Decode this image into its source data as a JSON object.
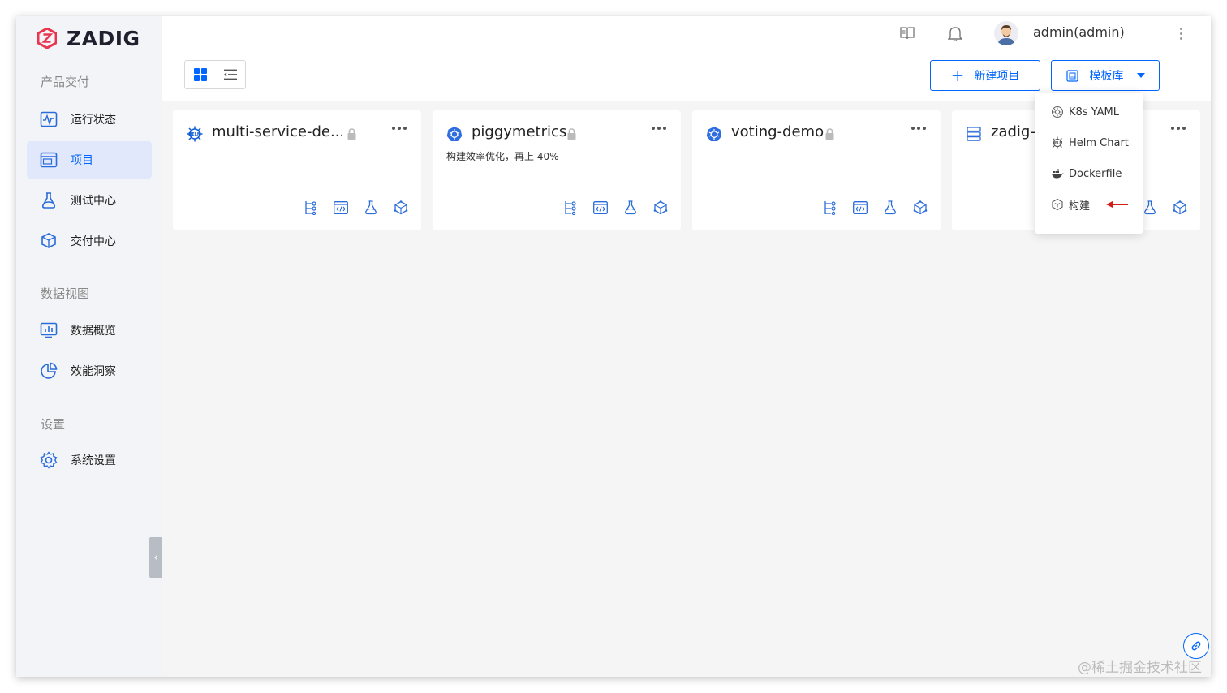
{
  "brand": {
    "name": "ZADIG",
    "accent": "#0066ff",
    "logo_color": "#e8364e"
  },
  "sidebar": {
    "sections": [
      {
        "title": "产品交付",
        "items": [
          {
            "label": "运行状态",
            "icon": "pulse-monitor-icon"
          },
          {
            "label": "项目",
            "icon": "pm-window-icon",
            "active": true
          },
          {
            "label": "测试中心",
            "icon": "flask-icon"
          },
          {
            "label": "交付中心",
            "icon": "package-cube-icon"
          }
        ]
      },
      {
        "title": "数据视图",
        "items": [
          {
            "label": "数据概览",
            "icon": "bar-monitor-icon"
          },
          {
            "label": "效能洞察",
            "icon": "pie-chart-icon"
          }
        ]
      },
      {
        "title": "设置",
        "items": [
          {
            "label": "系统设置",
            "icon": "gear-icon"
          }
        ]
      }
    ],
    "collapse_glyph": "‹"
  },
  "header": {
    "username": "admin(admin)",
    "icons": [
      "book-icon",
      "bell-icon",
      "avatar",
      "more-vertical-icon"
    ]
  },
  "toolbar": {
    "new_project_label": "新建项目",
    "new_project_glyph": "+",
    "template_label": "模板库"
  },
  "projects": [
    {
      "name": "multi-service-de...",
      "type_icon": "helm-icon",
      "locked": true,
      "description": ""
    },
    {
      "name": "piggymetrics",
      "type_icon": "kubernetes-icon",
      "locked": true,
      "description": "构建效率优化，再上 40%"
    },
    {
      "name": "voting-demo",
      "type_icon": "kubernetes-icon",
      "locked": true,
      "description": ""
    },
    {
      "name": "zadig-t",
      "type_icon": "server-stack-icon",
      "locked": false,
      "description": ""
    }
  ],
  "card_actions": [
    "workflow-icon",
    "service-code-icon",
    "test-flask-icon",
    "environment-cube-icon"
  ],
  "template_menu": {
    "items": [
      {
        "label": "K8s YAML",
        "icon": "k8s-yaml-icon"
      },
      {
        "label": "Helm Chart",
        "icon": "helm-chart-icon"
      },
      {
        "label": "Dockerfile",
        "icon": "docker-icon"
      },
      {
        "label": "构建",
        "icon": "build-cube-icon"
      }
    ]
  },
  "watermark": "@稀土掘金技术社区"
}
